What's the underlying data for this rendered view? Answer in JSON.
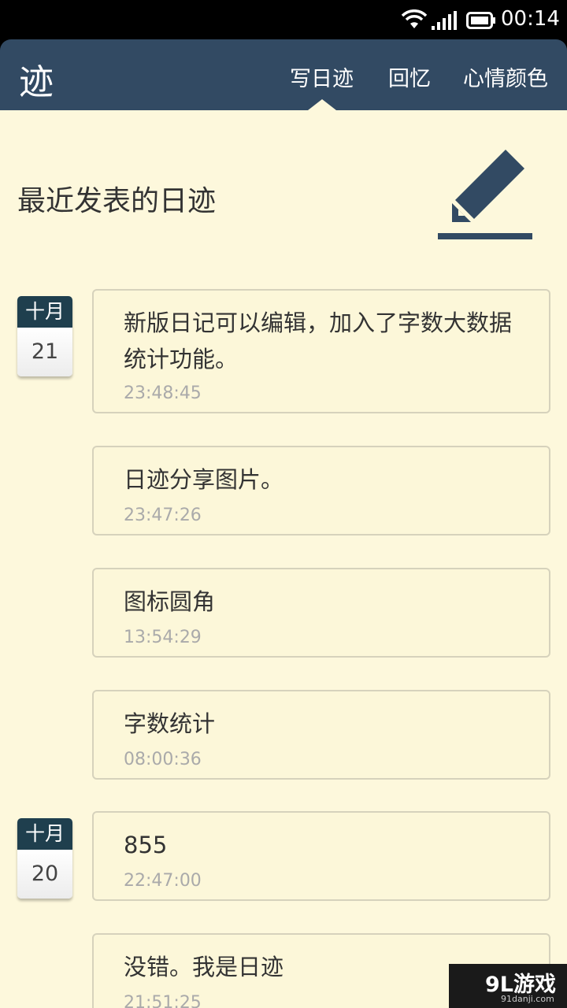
{
  "status_bar": {
    "time": "00:14"
  },
  "app_bar": {
    "logo": "迹",
    "tabs": [
      {
        "label": "写日迹",
        "active": true
      },
      {
        "label": "回忆",
        "active": false
      },
      {
        "label": "心情颜色",
        "active": false
      }
    ]
  },
  "main": {
    "section_title": "最近发表的日迹",
    "compose_icon": "pencil-icon",
    "date_groups": [
      {
        "month": "十月",
        "day": "21"
      },
      {
        "month": "十月",
        "day": "20"
      }
    ],
    "entries": [
      {
        "text": "新版日记可以编辑，加入了字数大数据统计功能。",
        "time": "23:48:45"
      },
      {
        "text": "日迹分享图片。",
        "time": "23:47:26"
      },
      {
        "text": "图标圆角",
        "time": "13:54:29"
      },
      {
        "text": "字数统计",
        "time": "08:00:36"
      },
      {
        "text": "855",
        "time": "22:47:00"
      },
      {
        "text": "没错。我是日迹",
        "time": "21:51:25"
      }
    ]
  },
  "watermark": {
    "logo": "9L游戏",
    "url": "91danji.com"
  },
  "colors": {
    "app_bar": "#324a63",
    "background": "#fdf8dc",
    "date_header": "#1f3f4e",
    "card_border": "#d6d2bc"
  }
}
